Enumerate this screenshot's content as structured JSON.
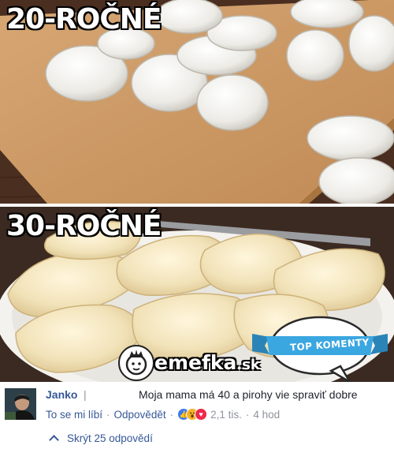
{
  "meme": {
    "top_caption": "20-ROČNÉ",
    "bottom_caption": "30-ROČNÉ",
    "watermark": "emefka",
    "watermark_tld": ".sk",
    "badge_label": "TOP KOMENTY"
  },
  "comment": {
    "author": "Janko",
    "separator": "|",
    "text": "Moja mama má 40 a pirohy vie spraviť dobre",
    "like_label": "To se mi líbí",
    "reply_label": "Odpovědět",
    "reaction_count": "2,1 tis.",
    "timestamp": "4 hod",
    "hide_replies_label": "Skrýt 25 odpovědí"
  },
  "colors": {
    "link": "#365899",
    "meta": "#90949c",
    "badge": "#3aa7e0"
  }
}
